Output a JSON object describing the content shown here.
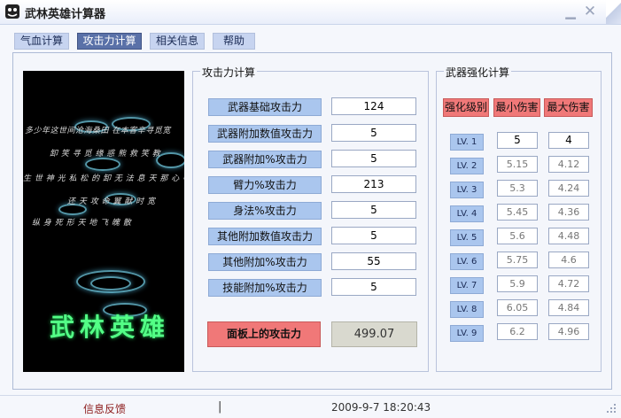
{
  "window": {
    "title": "武林英雄计算器",
    "min_icon": "minimize-icon",
    "close_icon": "close-icon"
  },
  "tabs": [
    {
      "label": "气血计算",
      "active": false
    },
    {
      "label": "攻击力计算",
      "active": true
    },
    {
      "label": "相关信息",
      "active": false
    },
    {
      "label": "帮助",
      "active": false
    }
  ],
  "splash": {
    "lines": [
      "多少年这世间沧海桑田 在本客辛寻觅宽",
      "卸 笑 寻 觅 缘 惑 熊 救 笑 教",
      "生 世 神 光 私 松 的 卸 无 法 息 天 那 心 中 的 积",
      "还 天 攻 命 翼 献 时 宽",
      "纵 身 死 形 天 地 飞 魄 散"
    ],
    "logo": "武林英雄"
  },
  "attack": {
    "group_title": "攻击力计算",
    "rows": [
      {
        "label": "武器基础攻击力",
        "value": "124"
      },
      {
        "label": "武器附加数值攻击力",
        "value": "5"
      },
      {
        "label": "武器附加%攻击力",
        "value": "5"
      },
      {
        "label": "臂力%攻击力",
        "value": "213"
      },
      {
        "label": "身法%攻击力",
        "value": "5"
      },
      {
        "label": "其他附加数值攻击力",
        "value": "5"
      },
      {
        "label": "其他附加%攻击力",
        "value": "55"
      },
      {
        "label": "技能附加%攻击力",
        "value": "5"
      }
    ],
    "result_label": "面板上的攻击力",
    "result_value": "499.07"
  },
  "weapon": {
    "group_title": "武器强化计算",
    "headers": [
      "强化级别",
      "最小伤害",
      "最大伤害"
    ],
    "rows": [
      {
        "level": "LV. 1",
        "min": "5",
        "max": "4"
      },
      {
        "level": "LV. 2",
        "min": "5.15",
        "max": "4.12"
      },
      {
        "level": "LV. 3",
        "min": "5.3",
        "max": "4.24"
      },
      {
        "level": "LV. 4",
        "min": "5.45",
        "max": "4.36"
      },
      {
        "level": "LV. 5",
        "min": "5.6",
        "max": "4.48"
      },
      {
        "level": "LV. 6",
        "min": "5.75",
        "max": "4.6"
      },
      {
        "level": "LV. 7",
        "min": "5.9",
        "max": "4.72"
      },
      {
        "level": "LV. 8",
        "min": "6.05",
        "max": "4.84"
      },
      {
        "level": "LV. 9",
        "min": "6.2",
        "max": "4.96"
      }
    ]
  },
  "status": {
    "feedback": "信息反馈",
    "separator": "|",
    "datetime": "2009-9-7 18:20:43"
  },
  "colors": {
    "accent_tab": "#5a71a8",
    "label_blue": "#aac6ee",
    "header_red": "#f07878"
  }
}
